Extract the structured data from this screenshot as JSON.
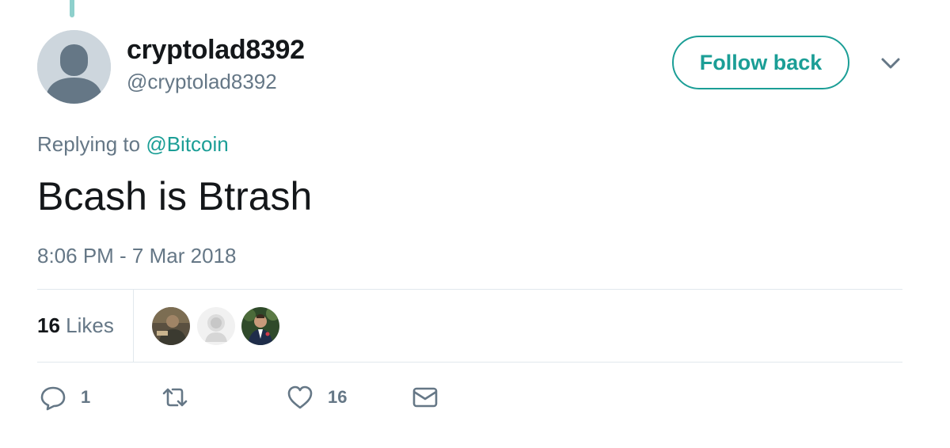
{
  "tweet": {
    "author": {
      "display_name": "cryptolad8392",
      "handle": "@cryptolad8392"
    },
    "follow_button_label": "Follow back",
    "replying_prefix": "Replying to",
    "replying_to": "@Bitcoin",
    "text": "Bcash is Btrash",
    "timestamp": "8:06 PM - 7 Mar 2018"
  },
  "stats": {
    "likes_count": "16",
    "likes_label": "Likes",
    "liker_avatars": [
      "avatar",
      "avatar",
      "avatar"
    ]
  },
  "actions": {
    "reply_count": "1",
    "like_count": "16"
  },
  "icons": {
    "reply": "reply-icon",
    "retweet": "retweet-icon",
    "like": "heart-icon",
    "dm": "envelope-icon",
    "menu": "chevron-down-icon"
  },
  "colors": {
    "accent": "#1b9e96",
    "muted_text": "#657786",
    "text": "#14171a",
    "divider": "#e1e8ed"
  }
}
